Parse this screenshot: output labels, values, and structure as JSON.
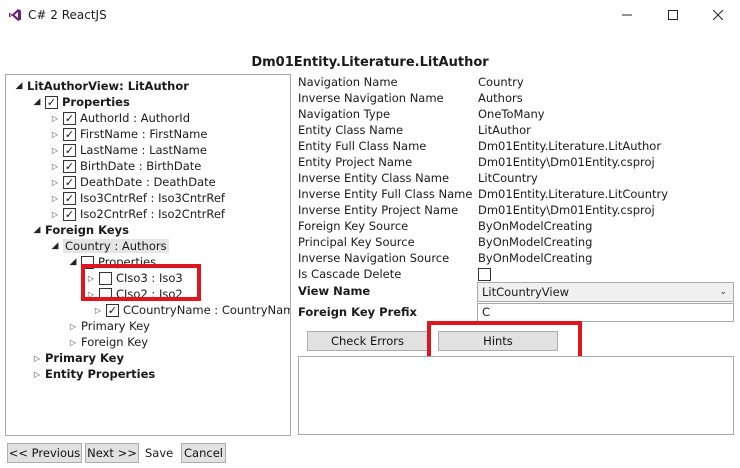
{
  "window": {
    "title": "C# 2 ReactJS"
  },
  "header": {
    "title": "Dm01Entity.Literature.LitAuthor"
  },
  "tree": {
    "root": "LitAuthorView: LitAuthor",
    "properties": "Properties",
    "props": [
      "AuthorId : AuthorId",
      "FirstName : FirstName",
      "LastName : LastName",
      "BirthDate : BirthDate",
      "DeathDate : DeathDate",
      "Iso3CntrRef : Iso3CntrRef",
      "Iso2CntrRef : Iso2CntrRef"
    ],
    "foreign_keys": "Foreign Keys",
    "fk_country": "Country : Authors",
    "fk_properties": "Properties",
    "fk_props": [
      "CIso3 : Iso3",
      "CIso2 : Iso2",
      "CCountryName : CountryName"
    ],
    "fk_primary_key": "Primary Key",
    "fk_foreign_key": "Foreign Key",
    "primary_key": "Primary Key",
    "entity_properties": "Entity Properties"
  },
  "properties": [
    {
      "label": "Navigation Name",
      "value": "Country"
    },
    {
      "label": "Inverse Navigation Name",
      "value": "Authors"
    },
    {
      "label": "Navigation Type",
      "value": "OneToMany"
    },
    {
      "label": "Entity Class Name",
      "value": "LitAuthor"
    },
    {
      "label": "Entity Full Class Name",
      "value": "Dm01Entity.Literature.LitAuthor"
    },
    {
      "label": "Entity Project Name",
      "value": "Dm01Entity\\Dm01Entity.csproj"
    },
    {
      "label": "Inverse Entity Class Name",
      "value": "LitCountry"
    },
    {
      "label": "Inverse Entity Full Class Name",
      "value": "Dm01Entity.Literature.LitCountry"
    },
    {
      "label": "Inverse Entity Project Name",
      "value": "Dm01Entity\\Dm01Entity.csproj"
    },
    {
      "label": "Foreign Key Source",
      "value": "ByOnModelCreating"
    },
    {
      "label": "Principal Key Source",
      "value": "ByOnModelCreating"
    },
    {
      "label": "Inverse Navigation Source",
      "value": "ByOnModelCreating"
    }
  ],
  "cascade_label": "Is Cascade Delete",
  "view_name": {
    "label": "View Name",
    "value": "LitCountryView"
  },
  "fk_prefix": {
    "label": "Foreign Key Prefix",
    "value": "C"
  },
  "buttons": {
    "check_errors": "Check Errors",
    "hints": "Hints",
    "previous": "<< Previous",
    "next": "Next >>",
    "save": "Save",
    "cancel": "Cancel"
  },
  "colors": {
    "highlight": "#e0161f"
  }
}
